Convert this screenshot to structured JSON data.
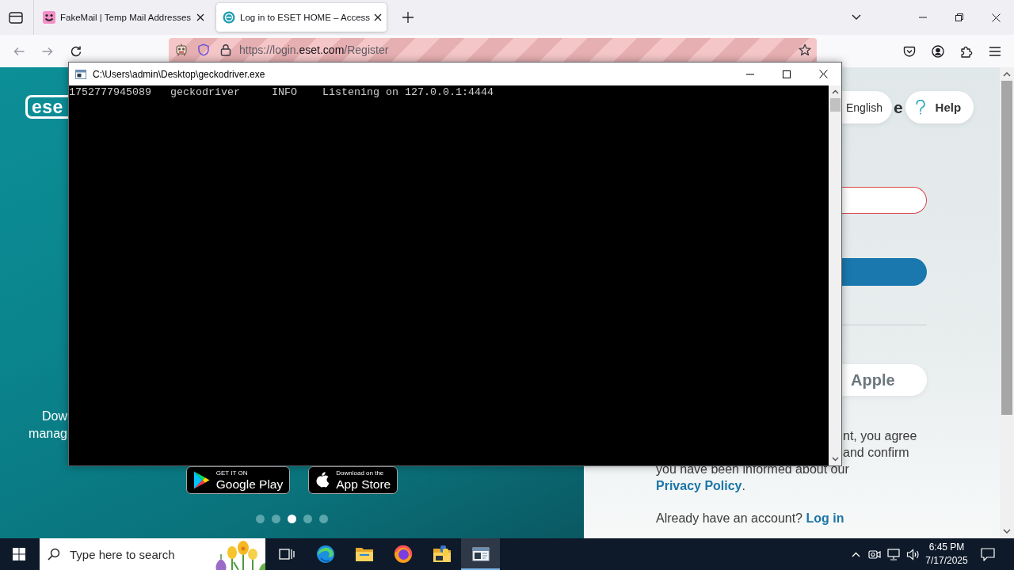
{
  "browser": {
    "tabs": [
      {
        "title": "FakeMail | Temp Mail Addresses",
        "selected": false
      },
      {
        "title": "Log in to ESET HOME – Access",
        "selected": true
      }
    ],
    "address_bar": {
      "remote_controlled": true,
      "url_prefix": "https://login.",
      "url_domain": "eset.com",
      "url_path": "/Register"
    }
  },
  "page": {
    "left_panel": {
      "logo": "ese",
      "promo_lines": [
        "Dow",
        "manag"
      ],
      "store_badges": [
        {
          "kind": "google-play",
          "caption": "GET IT ON",
          "name": "Google Play"
        },
        {
          "kind": "app-store",
          "caption": "Download on the",
          "name": "App Store"
        }
      ],
      "carousel_dots": [
        {
          "selected": false
        },
        {
          "selected": false
        },
        {
          "selected": true
        },
        {
          "selected": false
        },
        {
          "selected": false
        }
      ]
    },
    "right_panel": {
      "language_button": "English",
      "heading_fragment": "e",
      "help_button": "Help",
      "email_field": {
        "invalid": true
      },
      "social_button": "Apple",
      "consent_fragments": [
        "nt, you agree",
        "and confirm"
      ],
      "consent_text": {
        "before": "you have been informed about our",
        "link": "Privacy Policy",
        "after": "."
      },
      "login_prompt": {
        "text": "Already have an account?",
        "link": "Log in"
      }
    }
  },
  "console_window": {
    "title": "C:\\Users\\admin\\Desktop\\geckodriver.exe",
    "lines": [
      "1752777945089   geckodriver     INFO    Listening on 127.0.0.1:4444"
    ]
  },
  "taskbar": {
    "search": {
      "placeholder": "Type here to search"
    },
    "apps": [
      {
        "kind": "task-view",
        "selected": false
      },
      {
        "kind": "edge",
        "selected": false
      },
      {
        "kind": "explorer",
        "selected": false
      },
      {
        "kind": "firefox",
        "selected": false
      },
      {
        "kind": "python",
        "selected": false
      },
      {
        "kind": "console",
        "selected": true
      }
    ],
    "clock": {
      "time": "6:45 PM",
      "date": "7/17/2025"
    }
  }
}
